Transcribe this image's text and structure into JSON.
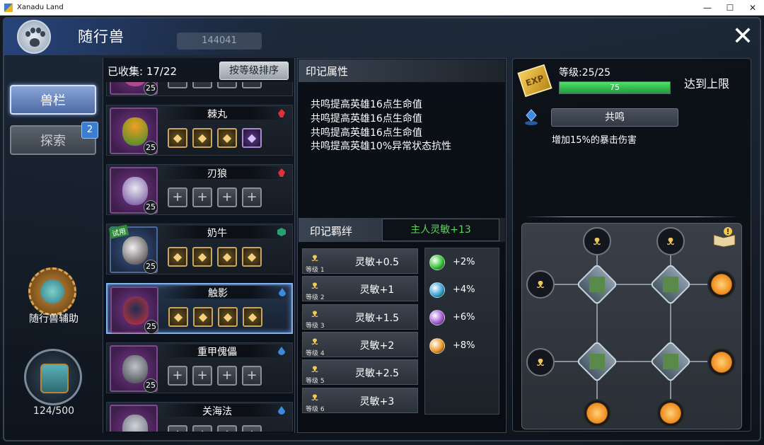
{
  "window": {
    "title": "Xanadu Land",
    "minimize": "—",
    "maximize": "☐",
    "close": "✕"
  },
  "header": {
    "title": "随行兽",
    "gold_value": "144041",
    "close_glyph": "✕"
  },
  "nav": {
    "items": [
      {
        "label": "兽栏",
        "active": true
      },
      {
        "label": "探索",
        "active": false,
        "badge": "2"
      }
    ],
    "assist_label": "随行兽辅助",
    "bag_count": "124/500"
  },
  "pet_list": {
    "collected_label": "已收集: 17/22",
    "sort_button": "按等级排序",
    "pets": [
      {
        "name": "",
        "level": "25",
        "slots": [
          "empty",
          "empty",
          "empty",
          "empty"
        ]
      },
      {
        "name": "棘丸",
        "level": "25",
        "type": "red",
        "slots": [
          "gem",
          "gem",
          "gem",
          "gem-purple"
        ]
      },
      {
        "name": "刃狼",
        "level": "25",
        "type": "red",
        "slots": [
          "empty",
          "empty",
          "empty",
          "empty"
        ]
      },
      {
        "name": "奶牛",
        "level": "25",
        "type": "green",
        "trial_tag": "试用",
        "slots": [
          "gem",
          "gem",
          "gem",
          "gem"
        ]
      },
      {
        "name": "触影",
        "level": "25",
        "type": "blue",
        "selected": true,
        "slots": [
          "gem",
          "gem",
          "gem",
          "gem"
        ]
      },
      {
        "name": "重甲傀儡",
        "level": "25",
        "type": "blue",
        "slots": [
          "empty",
          "empty",
          "empty",
          "empty"
        ]
      },
      {
        "name": "关海法",
        "level": "",
        "type": "blue",
        "slots": [
          "empty",
          "empty",
          "empty",
          "empty"
        ]
      }
    ]
  },
  "mark": {
    "title": "印记属性",
    "attributes": [
      "共鸣提高英雄16点生命值",
      "共鸣提高英雄16点生命值",
      "共鸣提高英雄16点生命值",
      "共鸣提高英雄10%异常状态抗性"
    ],
    "bond_title": "印记羁绊",
    "bond_value": "主人灵敏+13",
    "bond_levels": [
      {
        "level": "等级 1",
        "value": "灵敏+0.5"
      },
      {
        "level": "等级 2",
        "value": "灵敏+1"
      },
      {
        "level": "等级 3",
        "value": "灵敏+1.5"
      },
      {
        "level": "等级 4",
        "value": "灵敏+2"
      },
      {
        "level": "等级 5",
        "value": "灵敏+2.5"
      },
      {
        "level": "等级 6",
        "value": "灵敏+3"
      }
    ],
    "orbs": [
      {
        "color": "#38c838",
        "label": "+2%"
      },
      {
        "color": "#3aa8d8",
        "label": "+4%"
      },
      {
        "color": "#a860d8",
        "label": "+6%"
      },
      {
        "color": "#f09a28",
        "label": "+8%"
      }
    ]
  },
  "right": {
    "exp_icon_label": "EXP",
    "level_text": "等级:25/25",
    "exp_value": "75",
    "exp_fraction": 1.0,
    "maxed_text": "达到上限",
    "resonance_button": "共鸣",
    "resonance_desc": "增加15%的暴击伤害"
  }
}
